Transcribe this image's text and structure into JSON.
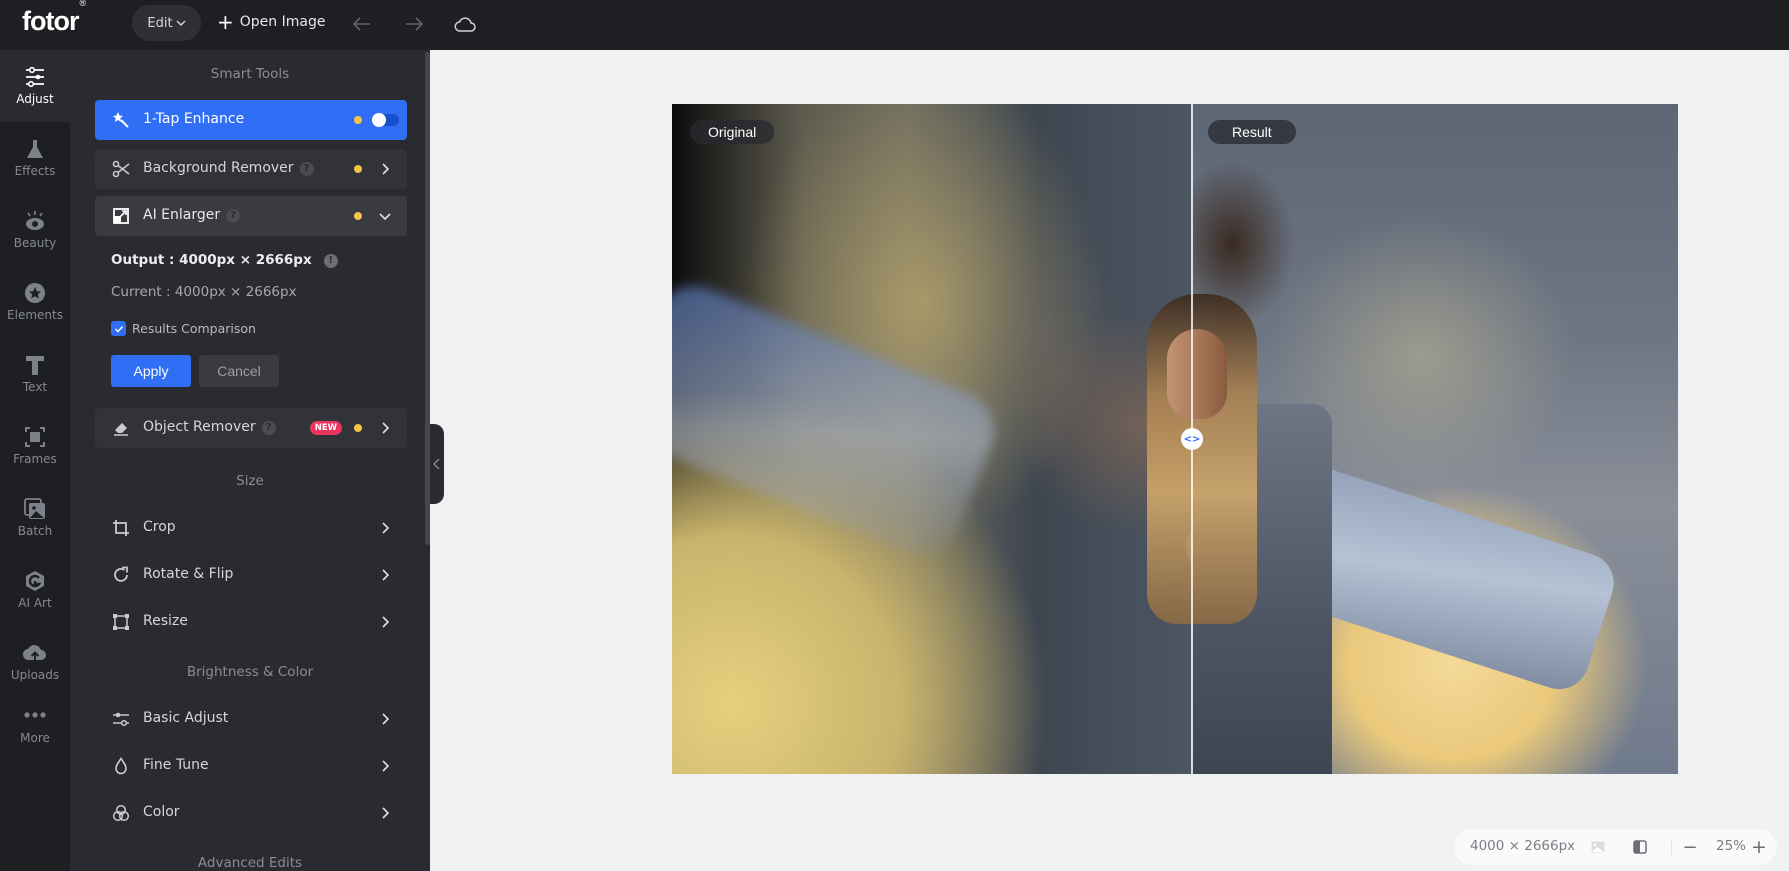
{
  "app": {
    "logo": "fotor",
    "logo_mark": "®"
  },
  "header": {
    "edit_label": "Edit",
    "open_image_label": "Open Image",
    "icons": [
      "undo-arrow-icon",
      "redo-arrow-icon",
      "cloud-icon"
    ]
  },
  "rail": {
    "items": [
      {
        "label": "Adjust",
        "icon": "sliders-icon",
        "active": true
      },
      {
        "label": "Effects",
        "icon": "flask-icon"
      },
      {
        "label": "Beauty",
        "icon": "eye-icon"
      },
      {
        "label": "Elements",
        "icon": "star-circle-icon"
      },
      {
        "label": "Text",
        "icon": "text-t-icon"
      },
      {
        "label": "Frames",
        "icon": "frame-icon"
      },
      {
        "label": "Batch",
        "icon": "batch-images-icon"
      },
      {
        "label": "AI Art",
        "icon": "ai-art-hexagon-icon"
      },
      {
        "label": "Uploads",
        "icon": "cloud-upload-icon"
      },
      {
        "label": "More",
        "icon": "more-dots-icon"
      }
    ]
  },
  "panel": {
    "smart_tools_title": "Smart Tools",
    "tools": {
      "tap_enhance": {
        "label": "1-Tap Enhance",
        "toggle_on": false
      },
      "bg_remover": {
        "label": "Background Remover"
      },
      "ai_enlarger": {
        "label": "AI Enlarger"
      },
      "object_remover": {
        "label": "Object Remover",
        "badge": "NEW"
      }
    },
    "enlarger": {
      "output": "Output : 4000px × 2666px",
      "current": "Current : 4000px × 2666px",
      "results_comparison_label": "Results Comparison",
      "results_comparison_checked": true,
      "apply_label": "Apply",
      "cancel_label": "Cancel"
    },
    "size_title": "Size",
    "size_items": [
      {
        "label": "Crop",
        "icon": "crop-icon"
      },
      {
        "label": "Rotate & Flip",
        "icon": "rotate-icon"
      },
      {
        "label": "Resize",
        "icon": "resize-icon"
      }
    ],
    "brightness_title": "Brightness & Color",
    "brightness_items": [
      {
        "label": "Basic Adjust",
        "icon": "sliders-icon"
      },
      {
        "label": "Fine Tune",
        "icon": "droplet-icon"
      },
      {
        "label": "Color",
        "icon": "color-circles-icon"
      }
    ],
    "advanced_title": "Advanced Edits"
  },
  "canvas": {
    "original_label": "Original",
    "result_label": "Result",
    "compare_handle": "<>"
  },
  "status": {
    "dimensions": "4000 × 2666px",
    "zoom": "25%",
    "zoom_out": "−",
    "zoom_in": "+"
  },
  "colors": {
    "accent": "#2f6ef5",
    "dot": "#f5c444",
    "new_badge": "#e8345f",
    "header_bg": "#1e1f23",
    "panel_bg": "#2a2b30"
  }
}
